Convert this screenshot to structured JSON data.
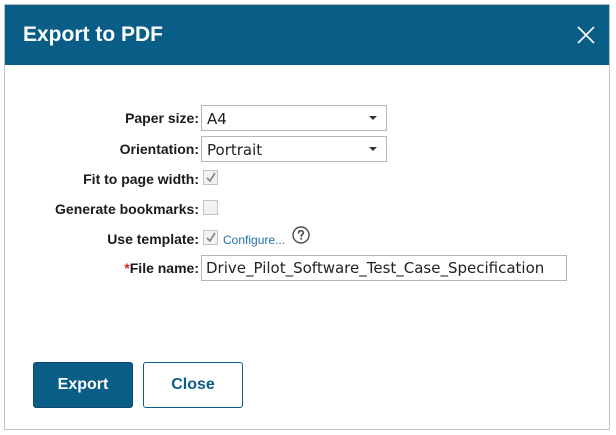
{
  "dialog": {
    "title": "Export to PDF",
    "close_icon": "close-icon"
  },
  "form": {
    "paper_size": {
      "label": "Paper size:",
      "value": "A4"
    },
    "orientation": {
      "label": "Orientation:",
      "value": "Portrait"
    },
    "fit_to_page_width": {
      "label": "Fit to page width:",
      "checked": true
    },
    "generate_bookmarks": {
      "label": "Generate bookmarks:",
      "checked": false
    },
    "use_template": {
      "label": "Use template:",
      "checked": true,
      "link": "Configure...",
      "help_icon": "question-circle-icon"
    },
    "file_name": {
      "required_marker": "*",
      "label": "File name:",
      "value": "Drive_Pilot_Software_Test_Case_Specification"
    }
  },
  "buttons": {
    "export_label": "Export",
    "close_label": "Close"
  },
  "colors": {
    "accent": "#0a5d87",
    "required": "#d22a2a",
    "link": "#1f6fa8"
  }
}
